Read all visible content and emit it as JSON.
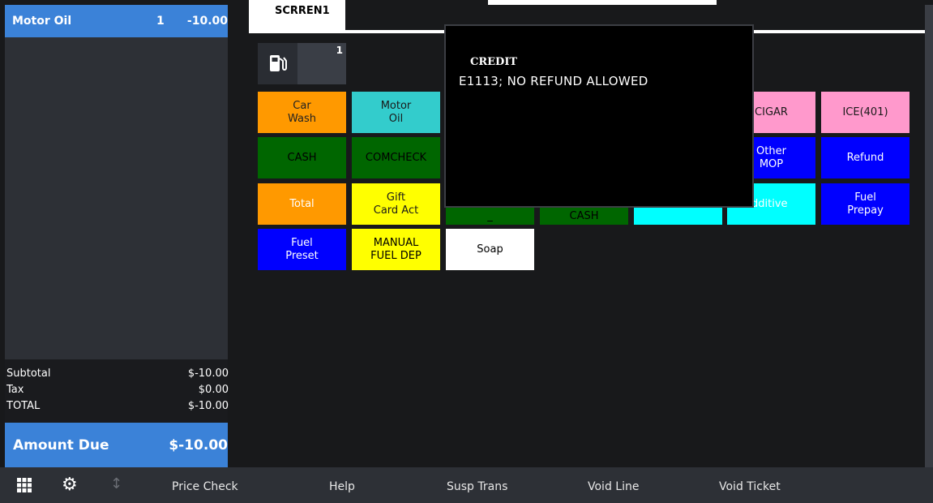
{
  "ticket": {
    "line_item": {
      "name": "Motor Oil",
      "qty": "1",
      "amount": "-10.00"
    },
    "subtotal": {
      "label": "Subtotal",
      "value": "$-10.00"
    },
    "tax": {
      "label": "Tax",
      "value": "$0.00"
    },
    "total": {
      "label": "TOTAL",
      "value": "$-10.00"
    },
    "amount_due": {
      "label": "Amount Due",
      "value": "$-10.00"
    }
  },
  "tab": {
    "label": "SCRREN1"
  },
  "pump": {
    "number": "1",
    "icon": "fuel-pump-icon"
  },
  "buttons": [
    {
      "label": "Car\nWash",
      "bg": "#ff9900",
      "fg": "#222222"
    },
    {
      "label": "Motor\nOil",
      "bg": "#33cccc",
      "fg": "#1a1a1a"
    },
    {
      "label": "CIGAR",
      "bg": "#ff99cc",
      "fg": "#1a1a1a"
    },
    {
      "label": "ICE(401)",
      "bg": "#ff99cc",
      "fg": "#1a1a1a"
    },
    {
      "label": "CASH",
      "bg": "#006600",
      "fg": "#000000"
    },
    {
      "label": "COMCHECK",
      "bg": "#006600",
      "fg": "#000000"
    },
    {
      "label": "Other\nMOP",
      "bg": "#0000ff",
      "fg": "#ffffff"
    },
    {
      "label": "Refund",
      "bg": "#0000ff",
      "fg": "#ffffff"
    },
    {
      "label": "Total",
      "bg": "#ff9900",
      "fg": "#ffffff"
    },
    {
      "label": "Gift\nCard Act",
      "bg": "#ffff00",
      "fg": "#1a1a1a"
    },
    {
      "label": "_",
      "bg": "#006600",
      "fg": "#000000"
    },
    {
      "label": "CASH",
      "bg": "#006600",
      "fg": "#000000"
    },
    {
      "label": "",
      "bg": "#00ffff",
      "fg": "#000000"
    },
    {
      "label": "dditive",
      "bg": "#00ffff",
      "fg": "#ffffff"
    },
    {
      "label": "Fuel\nPrepay",
      "bg": "#0000ff",
      "fg": "#ffffff"
    },
    {
      "label": "Fuel\nPreset",
      "bg": "#0000ff",
      "fg": "#ffffff"
    },
    {
      "label": "MANUAL\nFUEL DEP",
      "bg": "#ffff00",
      "fg": "#000000"
    },
    {
      "label": "Soap",
      "bg": "#ffffff",
      "fg": "#000000"
    }
  ],
  "modal": {
    "title": "CREDIT",
    "message": "E1113; NO REFUND ALLOWED"
  },
  "toolbar": {
    "icons": [
      "grid-menu-icon",
      "gear-icon",
      "sort-arrows-icon"
    ],
    "items": [
      "Price Check",
      "Help",
      "Susp Trans",
      "Void Line",
      "Void Ticket"
    ]
  },
  "colors": {
    "accent": "#3b82d8",
    "panel": "#2d3036",
    "background": "#18191b"
  }
}
